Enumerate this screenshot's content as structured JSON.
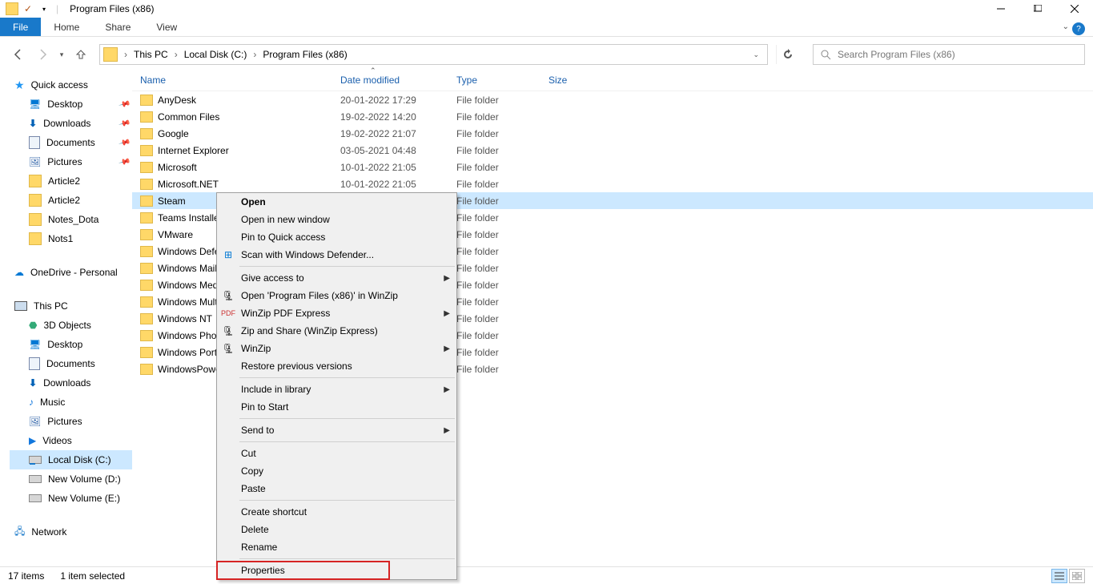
{
  "title": "Program Files (x86)",
  "ribbon": {
    "file": "File",
    "home": "Home",
    "share": "Share",
    "view": "View"
  },
  "breadcrumb": {
    "c0": "This PC",
    "c1": "Local Disk (C:)",
    "c2": "Program Files (x86)"
  },
  "search": {
    "placeholder": "Search Program Files (x86)"
  },
  "sidebar": {
    "quick": "Quick access",
    "desktop": "Desktop",
    "downloads": "Downloads",
    "documents": "Documents",
    "pictures": "Pictures",
    "article2a": "Article2",
    "article2b": "Article2",
    "notes_dota": "Notes_Dota",
    "nots1": "Nots1",
    "onedrive": "OneDrive - Personal",
    "thispc": "This PC",
    "objects3d": "3D Objects",
    "desktop2": "Desktop",
    "documents2": "Documents",
    "downloads2": "Downloads",
    "music": "Music",
    "pictures2": "Pictures",
    "videos": "Videos",
    "localc": "Local Disk (C:)",
    "vold": "New Volume (D:)",
    "vole": "New Volume (E:)",
    "network": "Network"
  },
  "columns": {
    "name": "Name",
    "date": "Date modified",
    "type": "Type",
    "size": "Size"
  },
  "rows": [
    {
      "name": "AnyDesk",
      "date": "20-01-2022 17:29",
      "type": "File folder",
      "size": ""
    },
    {
      "name": "Common Files",
      "date": "19-02-2022 14:20",
      "type": "File folder",
      "size": ""
    },
    {
      "name": "Google",
      "date": "19-02-2022 21:07",
      "type": "File folder",
      "size": ""
    },
    {
      "name": "Internet Explorer",
      "date": "03-05-2021 04:48",
      "type": "File folder",
      "size": ""
    },
    {
      "name": "Microsoft",
      "date": "10-01-2022 21:05",
      "type": "File folder",
      "size": ""
    },
    {
      "name": "Microsoft.NET",
      "date": "10-01-2022 21:05",
      "type": "File folder",
      "size": ""
    },
    {
      "name": "Steam",
      "date": "",
      "type": "File folder",
      "size": "",
      "selected": true
    },
    {
      "name": "Teams Installer",
      "date": "",
      "type": "File folder",
      "size": ""
    },
    {
      "name": "VMware",
      "date": "",
      "type": "File folder",
      "size": ""
    },
    {
      "name": "Windows Defender",
      "date": "",
      "type": "File folder",
      "size": ""
    },
    {
      "name": "Windows Mail",
      "date": "",
      "type": "File folder",
      "size": ""
    },
    {
      "name": "Windows Media Player",
      "date": "",
      "type": "File folder",
      "size": ""
    },
    {
      "name": "Windows Multimedia Platform",
      "date": "",
      "type": "File folder",
      "size": ""
    },
    {
      "name": "Windows NT",
      "date": "",
      "type": "File folder",
      "size": ""
    },
    {
      "name": "Windows Photo Viewer",
      "date": "",
      "type": "File folder",
      "size": ""
    },
    {
      "name": "Windows Portable Devices",
      "date": "",
      "type": "File folder",
      "size": ""
    },
    {
      "name": "WindowsPowerShell",
      "date": "",
      "type": "File folder",
      "size": ""
    }
  ],
  "context": {
    "open": "Open",
    "open_new": "Open in new window",
    "pin_qa": "Pin to Quick access",
    "scan_def": "Scan with Windows Defender...",
    "give_access": "Give access to",
    "open_winzip": "Open 'Program Files (x86)' in WinZip",
    "pdf_express": "WinZip PDF Express",
    "zip_share": "Zip and Share (WinZip Express)",
    "winzip": "WinZip",
    "restore": "Restore previous versions",
    "include_lib": "Include in library",
    "pin_start": "Pin to Start",
    "send_to": "Send to",
    "cut": "Cut",
    "copy": "Copy",
    "paste": "Paste",
    "shortcut": "Create shortcut",
    "delete": "Delete",
    "rename": "Rename",
    "properties": "Properties"
  },
  "status": {
    "items": "17 items",
    "selected": "1 item selected"
  }
}
